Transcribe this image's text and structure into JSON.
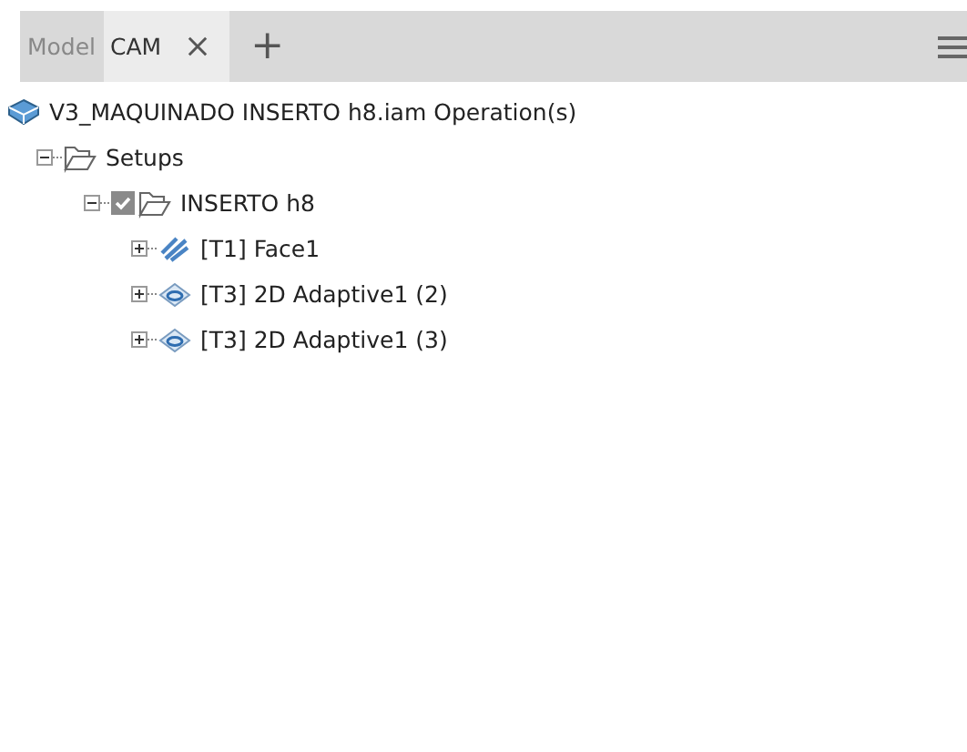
{
  "tabs": [
    {
      "label": "Model",
      "selected": false,
      "closable": false
    },
    {
      "label": "CAM",
      "selected": true,
      "closable": true
    }
  ],
  "add_tab": "+",
  "tree": [
    {
      "label": "V3_MAQUINADO INSERTO h8.iam Operation(s)",
      "kind": "document",
      "children": [
        {
          "label": "Setups",
          "kind": "folder",
          "expanded": true,
          "children": [
            {
              "label": "INSERTO h8",
              "kind": "setup",
              "expanded": true,
              "checked": true,
              "children": [
                {
                  "label": "[T1] Face1",
                  "kind": "face",
                  "expanded": false
                },
                {
                  "label": "[T3] 2D Adaptive1 (2)",
                  "kind": "adaptive",
                  "expanded": false
                },
                {
                  "label": "[T3] 2D Adaptive1 (3)",
                  "kind": "adaptive",
                  "expanded": false
                }
              ]
            }
          ]
        }
      ]
    }
  ]
}
